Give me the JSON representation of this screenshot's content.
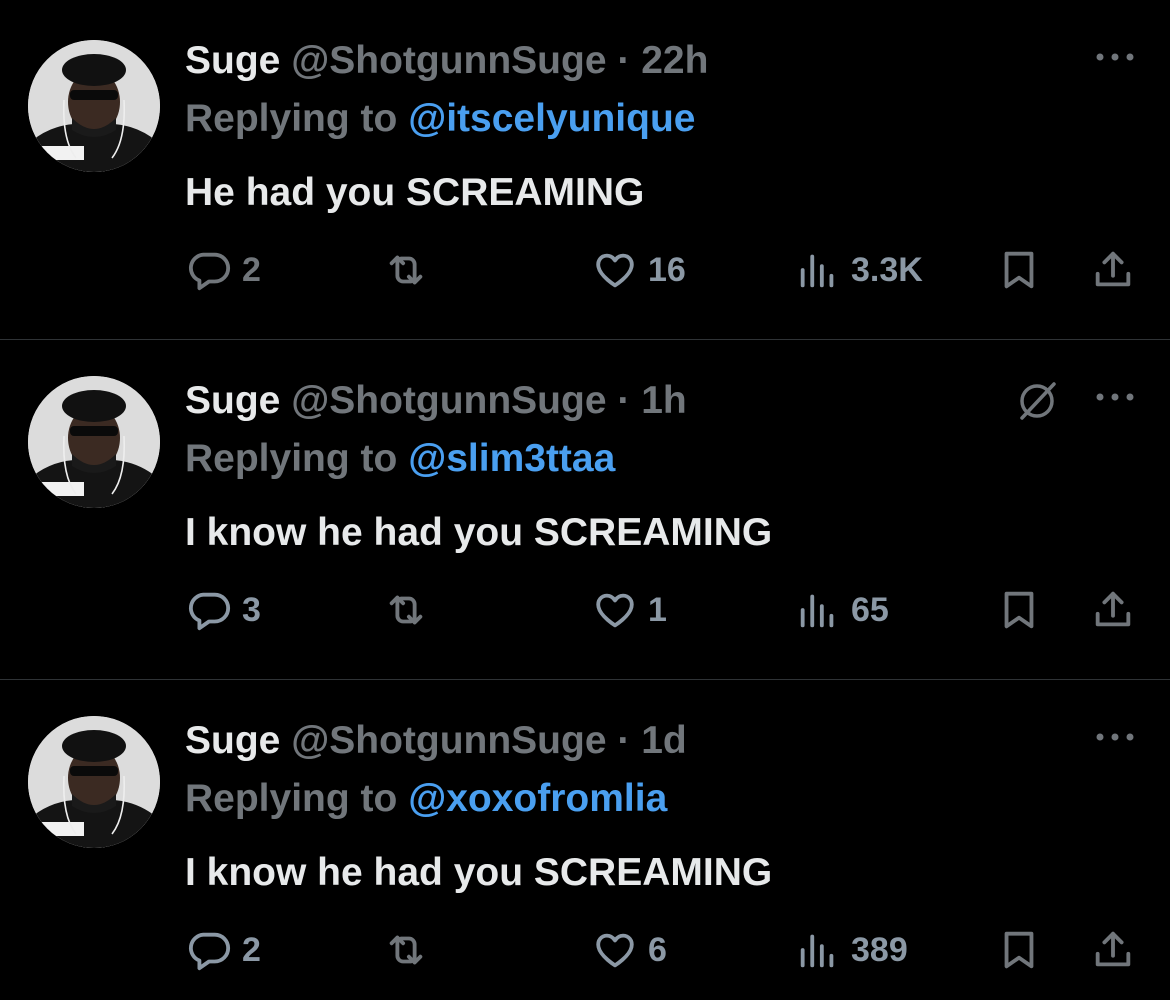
{
  "tweets": [
    {
      "name": "Suge",
      "handle": "@ShotgunnSuge",
      "dot": "·",
      "time": "22h",
      "replying_label": "Replying to",
      "replying_to": "@itscelyunique",
      "text": "He had you SCREAMING",
      "replies": "2",
      "likes": "16",
      "views": "3.3K",
      "has_grok_icon": false
    },
    {
      "name": "Suge",
      "handle": "@ShotgunnSuge",
      "dot": "·",
      "time": "1h",
      "replying_label": "Replying to",
      "replying_to": "@slim3ttaa",
      "text": "I know he had you SCREAMING",
      "replies": "3",
      "likes": "1",
      "views": "65",
      "has_grok_icon": true
    },
    {
      "name": "Suge",
      "handle": "@ShotgunnSuge",
      "dot": "·",
      "time": "1d",
      "replying_label": "Replying to",
      "replying_to": "@xoxofromlia",
      "text": "I know he had you SCREAMING",
      "replies": "2",
      "likes": "6",
      "views": "389",
      "has_grok_icon": false
    }
  ],
  "colors": {
    "background": "#000000",
    "text_primary": "#e7e9ea",
    "text_secondary": "#71767b",
    "mention": "#4a9ff0",
    "divider": "#2f3336"
  },
  "icons": [
    "reply-icon",
    "retweet-icon",
    "like-icon",
    "views-icon",
    "bookmark-icon",
    "share-icon",
    "more-icon",
    "grok-icon"
  ]
}
